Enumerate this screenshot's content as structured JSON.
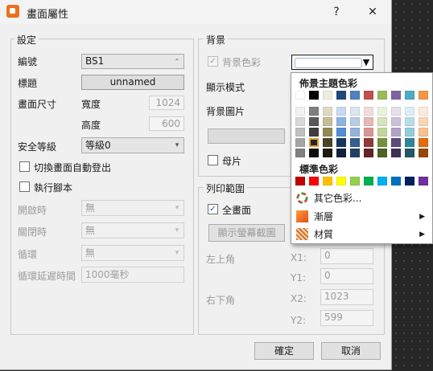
{
  "window": {
    "title": "畫面屬性",
    "help": "?",
    "close": "✕"
  },
  "settings": {
    "group_title": "設定",
    "id_label": "編號",
    "id_value": "BS1",
    "title_label": "標題",
    "title_value": "unnamed",
    "size_label": "畫面尺寸",
    "width_label": "寬度",
    "width_value": "1024",
    "height_label": "高度",
    "height_value": "600",
    "security_label": "安全等級",
    "security_value": "等級0",
    "auto_logout_label": "切換畫面自動登出",
    "run_macro_label": "執行腳本",
    "open_label": "開啟時",
    "open_value": "無",
    "close_label": "關閉時",
    "close_value": "無",
    "loop_label": "循環",
    "loop_value": "無",
    "loop_delay_label": "循環延遲時間",
    "loop_delay_value": "1000毫秒"
  },
  "background": {
    "group_title": "背景",
    "bg_color_label": "背景色彩",
    "display_mode_label": "顯示模式",
    "bg_image_label": "背景圖片",
    "master_label": "母片"
  },
  "print_area": {
    "group_title": "列印範圍",
    "full_screen_label": "全畫面",
    "show_capture_button": "顯示螢幕截圖",
    "top_left_label": "左上角",
    "bottom_right_label": "右下角",
    "x1_label": "X1:",
    "x1_value": "0",
    "y1_label": "Y1:",
    "y1_value": "0",
    "x2_label": "X2:",
    "x2_value": "1023",
    "y2_label": "Y2:",
    "y2_value": "599"
  },
  "buttons": {
    "ok": "確定",
    "cancel": "取消"
  },
  "color_popup": {
    "theme_title": "佈景主題色彩",
    "standard_title": "標準色彩",
    "more_colors": "其它色彩...",
    "gradient": "漸層",
    "texture": "材質",
    "theme_columns": [
      [
        "#ffffff",
        "#f2f2f2",
        "#d8d8d8",
        "#bfbfbf",
        "#a5a5a5",
        "#7f7f7f"
      ],
      [
        "#000000",
        "#7f7f7f",
        "#595959",
        "#3f3f3f",
        "#262626",
        "#0d0d0d"
      ],
      [
        "#eeece1",
        "#ddd9c3",
        "#c4bd97",
        "#938953",
        "#494429",
        "#1d1b10"
      ],
      [
        "#1f497d",
        "#c6d9f0",
        "#8db3e2",
        "#548dd4",
        "#17365d",
        "#0f243e"
      ],
      [
        "#4f81bd",
        "#dbe5f1",
        "#b8cce4",
        "#95b3d7",
        "#366092",
        "#244061"
      ],
      [
        "#c0504d",
        "#f2dcdb",
        "#e5b9b7",
        "#d99694",
        "#953734",
        "#632423"
      ],
      [
        "#9bbb59",
        "#ebf1dd",
        "#d7e3bc",
        "#c3d69b",
        "#76923c",
        "#4f6128"
      ],
      [
        "#8064a2",
        "#e5e0ec",
        "#ccc1d9",
        "#b2a2c7",
        "#5f497a",
        "#3f3151"
      ],
      [
        "#4bacc6",
        "#dbeef3",
        "#b7dde8",
        "#92cddc",
        "#31859b",
        "#205867"
      ],
      [
        "#f79646",
        "#fdeada",
        "#fbd5b5",
        "#fac08f",
        "#e36c09",
        "#974806"
      ]
    ],
    "standard_colors": [
      "#c00000",
      "#ff0000",
      "#ffc000",
      "#ffff00",
      "#92d050",
      "#00b050",
      "#00b0f0",
      "#0070c0",
      "#002060",
      "#7030a0"
    ]
  }
}
